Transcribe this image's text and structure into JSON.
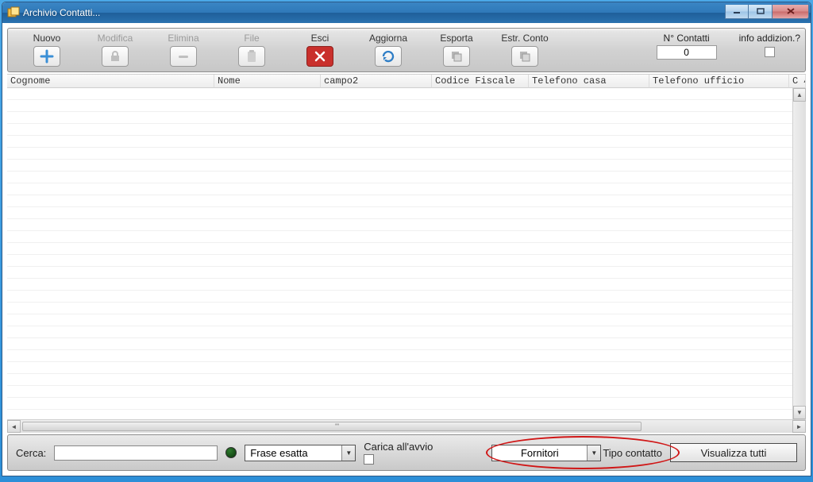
{
  "window": {
    "title": "Archivio Contatti..."
  },
  "toolbar": {
    "nuovo": {
      "label": "Nuovo"
    },
    "modifica": {
      "label": "Modifica"
    },
    "elimina": {
      "label": "Elimina"
    },
    "file": {
      "label": "File"
    },
    "esci": {
      "label": "Esci"
    },
    "aggiorna": {
      "label": "Aggiorna"
    },
    "esporta": {
      "label": "Esporta"
    },
    "estrconto": {
      "label": "Estr. Conto"
    },
    "ncontatti": {
      "label": "N° Contatti",
      "value": "0"
    },
    "infoadd": {
      "label": "info addizion.?"
    }
  },
  "grid": {
    "columns": {
      "c1": "Cognome",
      "c2": "Nome",
      "c3": "campo2",
      "c4": "Codice Fiscale",
      "c5": "Telefono casa",
      "c6": "Telefono ufficio",
      "c7": "C"
    }
  },
  "bottom": {
    "cerca_label": "Cerca:",
    "frase_value": "Frase esatta",
    "carica_label": "Carica all'avvio",
    "tipo_value": "Fornitori",
    "tipo_label": "Tipo contatto",
    "visualizza_label": "Visualizza tutti"
  }
}
